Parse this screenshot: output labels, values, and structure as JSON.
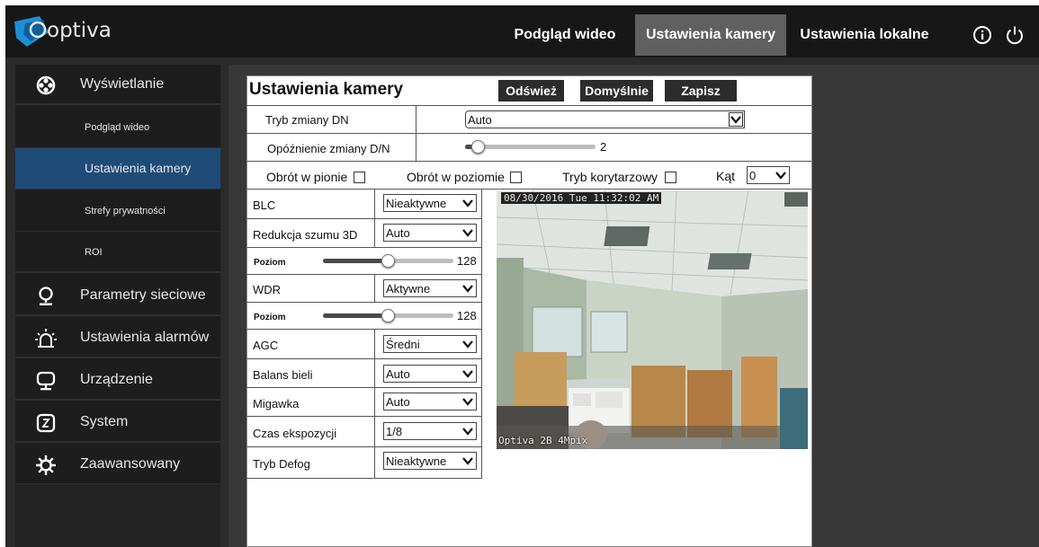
{
  "header": {
    "logo_text": "optiva",
    "nav": [
      {
        "label": "Podgląd wideo"
      },
      {
        "label": "Ustawienia kamery"
      },
      {
        "label": "Ustawienia lokalne"
      }
    ]
  },
  "sidebar": {
    "display": "Wyświetlanie",
    "sub_items": [
      "Podgląd wideo",
      "Ustawienia kamery",
      "Strefy prywatności",
      "ROI"
    ],
    "items": [
      "Parametry sieciowe",
      "Ustawienia alarmów",
      "Urządzenie",
      "System",
      "Zaawansowany"
    ]
  },
  "settings": {
    "title": "Ustawienia kamery",
    "buttons": {
      "refresh": "Odśwież",
      "default": "Domyślnie",
      "save": "Zapisz"
    },
    "dn_mode": {
      "label": "Tryb zmiany DN",
      "value": "Auto"
    },
    "dn_delay": {
      "label": "Opóźnienie zmiany D/N",
      "value": "2",
      "fraction": 0.05
    },
    "flip_v": "Obrót w pionie",
    "flip_h": "Obrót w poziomie",
    "corridor": "Tryb korytarzowy",
    "angle": {
      "label": "Kąt",
      "value": "0"
    },
    "blc": {
      "label": "BLC",
      "value": "Nieaktywne"
    },
    "nr3d": {
      "label": "Redukcja szumu 3D",
      "value": "Auto"
    },
    "nr_level": {
      "label": "Poziom",
      "value": "128",
      "fraction": 0.5
    },
    "wdr": {
      "label": "WDR",
      "value": "Aktywne"
    },
    "wdr_level": {
      "label": "Poziom",
      "value": "128",
      "fraction": 0.5
    },
    "agc": {
      "label": "AGC",
      "value": "Średni"
    },
    "wb": {
      "label": "Balans bieli",
      "value": "Auto"
    },
    "shutter": {
      "label": "Migawka",
      "value": "Auto"
    },
    "exposure": {
      "label": "Czas ekspozycji",
      "value": "1/8"
    },
    "defog": {
      "label": "Tryb Defog",
      "value": "Nieaktywne"
    }
  },
  "video": {
    "timestamp": "08/30/2016 Tue 11:32:02 AM",
    "camera_name": "Optiva 2B 4Mpix"
  },
  "colors": {
    "accent": "#1f4b78",
    "topbar": "#171717",
    "active_nav": "#606060"
  }
}
